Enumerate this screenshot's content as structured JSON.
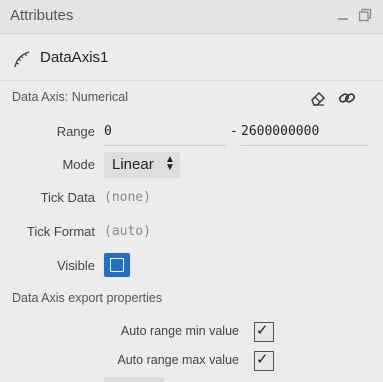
{
  "panel": {
    "title": "Attributes",
    "minimize_icon": "minimize-icon",
    "float_icon": "float-window-icon"
  },
  "header": {
    "icon": "data-axis-icon",
    "name": "DataAxis1"
  },
  "section1": {
    "label": "Data Axis: Numerical",
    "tools": [
      "eraser-icon",
      "link-icon"
    ]
  },
  "fields": {
    "range": {
      "label": "Range",
      "min": "0",
      "separator": "-",
      "max": "2600000000"
    },
    "mode": {
      "label": "Mode",
      "value": "Linear",
      "arrows": "▲\n▼"
    },
    "tick_data": {
      "label": "Tick Data",
      "value": "(none)"
    },
    "tick_format": {
      "label": "Tick Format",
      "value": "(auto)"
    },
    "visible": {
      "label": "Visible",
      "checked": false
    }
  },
  "section2": {
    "label": "Data Axis export properties"
  },
  "export": {
    "auto_min": {
      "label": "Auto range min value",
      "checked": true,
      "mark": "✓"
    },
    "auto_max": {
      "label": "Auto range max value",
      "checked": true,
      "mark": "✓"
    }
  },
  "colors": {
    "accent": "#1f6fd1",
    "background": "#ececec"
  }
}
